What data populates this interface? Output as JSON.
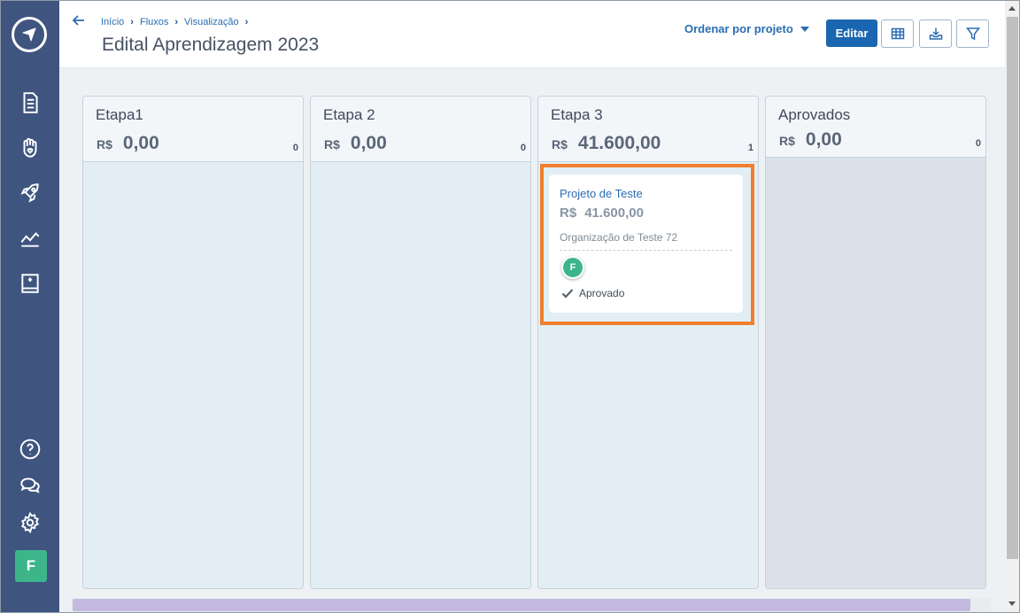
{
  "header": {
    "breadcrumb": [
      "Início",
      "Fluxos",
      "Visualização"
    ],
    "title": "Edital Aprendizagem 2023",
    "sort_label": "Ordenar por projeto",
    "edit_label": "Editar"
  },
  "sidebar": {
    "icons": [
      "document-icon",
      "hand-heart-icon",
      "rocket-icon",
      "chart-line-icon",
      "book-icon",
      "help-icon",
      "chat-icon",
      "gear-icon"
    ],
    "avatar_initial": "F",
    "avatar_color": "#3db58a",
    "background": "#3f5580"
  },
  "columns": [
    {
      "title": "Etapa1",
      "currency": "R$",
      "amount": "0,00",
      "count": "0"
    },
    {
      "title": "Etapa 2",
      "currency": "R$",
      "amount": "0,00",
      "count": "0"
    },
    {
      "title": "Etapa 3",
      "currency": "R$",
      "amount": "41.600,00",
      "count": "1"
    },
    {
      "title": "Aprovados",
      "currency": "R$",
      "amount": "0,00",
      "count": "0"
    }
  ],
  "card": {
    "title": "Projeto de Teste",
    "currency": "R$",
    "amount": "41.600,00",
    "organization": "Organização de Teste 72",
    "avatar_initial": "F",
    "status": "Aprovado"
  },
  "colors": {
    "accent": "#1a66b0",
    "highlight": "#f07f2c"
  }
}
